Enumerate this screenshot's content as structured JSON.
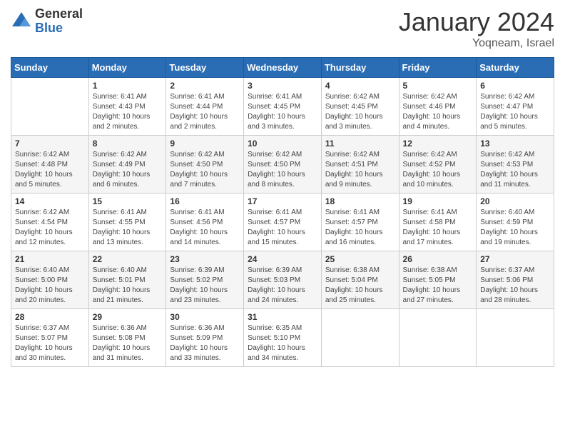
{
  "header": {
    "logo_general": "General",
    "logo_blue": "Blue",
    "month_title": "January 2024",
    "location": "Yoqneam, Israel"
  },
  "weekdays": [
    "Sunday",
    "Monday",
    "Tuesday",
    "Wednesday",
    "Thursday",
    "Friday",
    "Saturday"
  ],
  "weeks": [
    [
      {
        "day": "",
        "info": ""
      },
      {
        "day": "1",
        "info": "Sunrise: 6:41 AM\nSunset: 4:43 PM\nDaylight: 10 hours\nand 2 minutes."
      },
      {
        "day": "2",
        "info": "Sunrise: 6:41 AM\nSunset: 4:44 PM\nDaylight: 10 hours\nand 2 minutes."
      },
      {
        "day": "3",
        "info": "Sunrise: 6:41 AM\nSunset: 4:45 PM\nDaylight: 10 hours\nand 3 minutes."
      },
      {
        "day": "4",
        "info": "Sunrise: 6:42 AM\nSunset: 4:45 PM\nDaylight: 10 hours\nand 3 minutes."
      },
      {
        "day": "5",
        "info": "Sunrise: 6:42 AM\nSunset: 4:46 PM\nDaylight: 10 hours\nand 4 minutes."
      },
      {
        "day": "6",
        "info": "Sunrise: 6:42 AM\nSunset: 4:47 PM\nDaylight: 10 hours\nand 5 minutes."
      }
    ],
    [
      {
        "day": "7",
        "info": "Sunrise: 6:42 AM\nSunset: 4:48 PM\nDaylight: 10 hours\nand 5 minutes."
      },
      {
        "day": "8",
        "info": "Sunrise: 6:42 AM\nSunset: 4:49 PM\nDaylight: 10 hours\nand 6 minutes."
      },
      {
        "day": "9",
        "info": "Sunrise: 6:42 AM\nSunset: 4:50 PM\nDaylight: 10 hours\nand 7 minutes."
      },
      {
        "day": "10",
        "info": "Sunrise: 6:42 AM\nSunset: 4:50 PM\nDaylight: 10 hours\nand 8 minutes."
      },
      {
        "day": "11",
        "info": "Sunrise: 6:42 AM\nSunset: 4:51 PM\nDaylight: 10 hours\nand 9 minutes."
      },
      {
        "day": "12",
        "info": "Sunrise: 6:42 AM\nSunset: 4:52 PM\nDaylight: 10 hours\nand 10 minutes."
      },
      {
        "day": "13",
        "info": "Sunrise: 6:42 AM\nSunset: 4:53 PM\nDaylight: 10 hours\nand 11 minutes."
      }
    ],
    [
      {
        "day": "14",
        "info": "Sunrise: 6:42 AM\nSunset: 4:54 PM\nDaylight: 10 hours\nand 12 minutes."
      },
      {
        "day": "15",
        "info": "Sunrise: 6:41 AM\nSunset: 4:55 PM\nDaylight: 10 hours\nand 13 minutes."
      },
      {
        "day": "16",
        "info": "Sunrise: 6:41 AM\nSunset: 4:56 PM\nDaylight: 10 hours\nand 14 minutes."
      },
      {
        "day": "17",
        "info": "Sunrise: 6:41 AM\nSunset: 4:57 PM\nDaylight: 10 hours\nand 15 minutes."
      },
      {
        "day": "18",
        "info": "Sunrise: 6:41 AM\nSunset: 4:57 PM\nDaylight: 10 hours\nand 16 minutes."
      },
      {
        "day": "19",
        "info": "Sunrise: 6:41 AM\nSunset: 4:58 PM\nDaylight: 10 hours\nand 17 minutes."
      },
      {
        "day": "20",
        "info": "Sunrise: 6:40 AM\nSunset: 4:59 PM\nDaylight: 10 hours\nand 19 minutes."
      }
    ],
    [
      {
        "day": "21",
        "info": "Sunrise: 6:40 AM\nSunset: 5:00 PM\nDaylight: 10 hours\nand 20 minutes."
      },
      {
        "day": "22",
        "info": "Sunrise: 6:40 AM\nSunset: 5:01 PM\nDaylight: 10 hours\nand 21 minutes."
      },
      {
        "day": "23",
        "info": "Sunrise: 6:39 AM\nSunset: 5:02 PM\nDaylight: 10 hours\nand 23 minutes."
      },
      {
        "day": "24",
        "info": "Sunrise: 6:39 AM\nSunset: 5:03 PM\nDaylight: 10 hours\nand 24 minutes."
      },
      {
        "day": "25",
        "info": "Sunrise: 6:38 AM\nSunset: 5:04 PM\nDaylight: 10 hours\nand 25 minutes."
      },
      {
        "day": "26",
        "info": "Sunrise: 6:38 AM\nSunset: 5:05 PM\nDaylight: 10 hours\nand 27 minutes."
      },
      {
        "day": "27",
        "info": "Sunrise: 6:37 AM\nSunset: 5:06 PM\nDaylight: 10 hours\nand 28 minutes."
      }
    ],
    [
      {
        "day": "28",
        "info": "Sunrise: 6:37 AM\nSunset: 5:07 PM\nDaylight: 10 hours\nand 30 minutes."
      },
      {
        "day": "29",
        "info": "Sunrise: 6:36 AM\nSunset: 5:08 PM\nDaylight: 10 hours\nand 31 minutes."
      },
      {
        "day": "30",
        "info": "Sunrise: 6:36 AM\nSunset: 5:09 PM\nDaylight: 10 hours\nand 33 minutes."
      },
      {
        "day": "31",
        "info": "Sunrise: 6:35 AM\nSunset: 5:10 PM\nDaylight: 10 hours\nand 34 minutes."
      },
      {
        "day": "",
        "info": ""
      },
      {
        "day": "",
        "info": ""
      },
      {
        "day": "",
        "info": ""
      }
    ]
  ]
}
